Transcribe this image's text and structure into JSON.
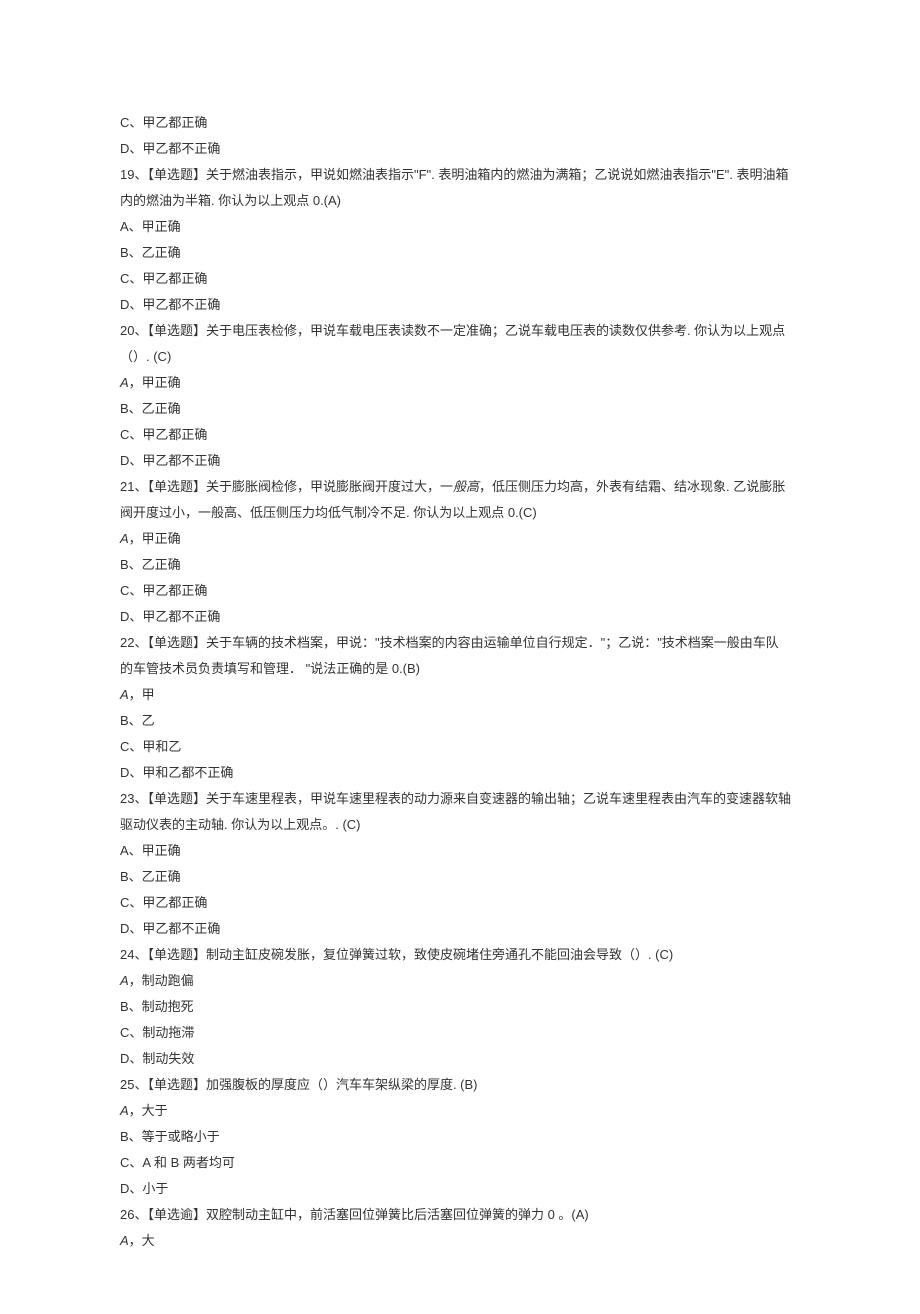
{
  "lines": {
    "l1": "C、甲乙都正确",
    "l2": "D、甲乙都不正确",
    "l3a": "19、【单选题】关于燃油表指示，甲说如燃油表指示\"F\". 表明油箱内的燃油为满箱；乙说说如燃油表指示\"E\". 表明油箱",
    "l3b": "内的燃油为半箱. 你认为以上观点 0.(A)",
    "l4": "A、甲正确",
    "l5": "B、乙正确",
    "l6": "C、甲乙都正确",
    "l7": "D、甲乙都不正确",
    "l8a": "20、【单选题】关于电压表检修，甲说车载电压表读数不一定准确；乙说车载电压表的读数仅供参考. 你认为以上观点",
    "l8b": "（）. (C)",
    "l9_a": "A",
    "l9_b": "，甲正确",
    "l10": "B、乙正确",
    "l11": "C、甲乙都正确",
    "l12": "D、甲乙都不正确",
    "l13a_pre": "21、【单选题】关于膨胀阀检修，甲说膨胀阀开度过大，一",
    "l13a_it": "般高",
    "l13a_post": "，低压侧压力均高，外表有结霜、结冰现象. 乙说膨胀",
    "l13b": "阀开度过小，一般高、低压侧压力均低气制冷不足. 你认为以上观点 0.(C)",
    "l14_a": "A",
    "l14_b": "，甲正确",
    "l15": "B、乙正确",
    "l16": "C、甲乙都正确",
    "l17": "D、甲乙都不正确",
    "l18a": "22、【单选题】关于车辆的技术档案，甲说：\"技术档案的内容由运输单位自行规定．\"；乙说：\"技术档案一般由车队",
    "l18b": "的车管技术员负责填写和管理． \"说法正确的是 0.(B)",
    "l19_a": "A",
    "l19_b": "，甲",
    "l20": "B、乙",
    "l21": "C、甲和乙",
    "l22": "D、甲和乙都不正确",
    "l23a": "23、【单选题】关于车速里程表，甲说车速里程表的动力源来自变速器的输出轴；乙说车速里程表由汽车的变速器软轴",
    "l23b": "驱动仪表的主动轴. 你认为以上观点。. (C)",
    "l24": "A、甲正确",
    "l25": "B、乙正确",
    "l26": "C、甲乙都正确",
    "l27": "D、甲乙都不正确",
    "l28": "24、【单选题】制动主缸皮碗发胀，复位弹簧过软，致使皮碗堵住旁通孔不能回油会导致（）. (C)",
    "l29_a": "A",
    "l29_b": "，制动跑偏",
    "l30": "B、制动抱死",
    "l31": "C、制动拖滞",
    "l32": "D、制动失效",
    "l33": "25、【单选题】加强腹板的厚度应（）汽车车架纵梁的厚度. (B)",
    "l34_a": "A",
    "l34_b": "，大于",
    "l35": "B、等于或略小于",
    "l36": "C、A 和 B 两者均可",
    "l37": "D、小于",
    "l38": "26、【单选逾】双腔制动主缸中，前活塞回位弹簧比后活塞回位弹簧的弹力 0 。(A)",
    "l39_a": "A",
    "l39_b": "，大"
  }
}
